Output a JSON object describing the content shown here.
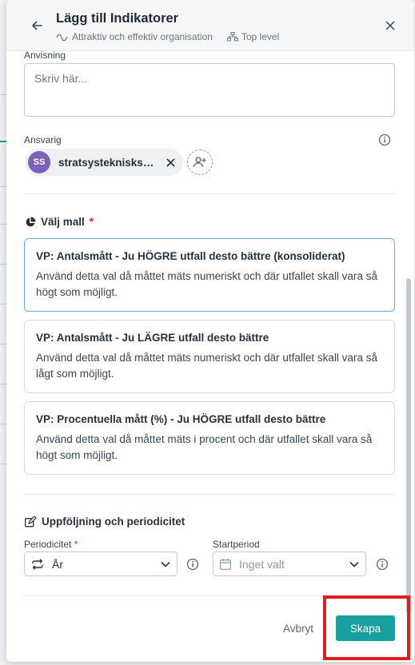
{
  "header": {
    "title": "Lägg till Indikatorer",
    "breadcrumb_item1": "Attraktiv och effektiv organisation",
    "breadcrumb_item2": "Top level"
  },
  "instructions": {
    "label": "Anvisning",
    "placeholder": "Skriv här..."
  },
  "responsible": {
    "label": "Ansvarig",
    "user_initials": "SS",
    "user_name": "stratsysteknisksupport"
  },
  "template_section": {
    "title": "Välj mall",
    "required_mark": "*",
    "templates": [
      {
        "title": "VP: Antalsmått - Ju HÖGRE utfall desto bättre (konsoliderat)",
        "description": "Använd detta val då måttet mäts numeriskt och där utfallet skall vara så högt som möjligt.",
        "selected": true
      },
      {
        "title": "VP: Antalsmått - Ju LÄGRE utfall desto bättre",
        "description": "Använd detta val då måttet mäts numeriskt och där utfallet skall vara så lågt som möjligt.",
        "selected": false
      },
      {
        "title": "VP: Procentuella mått (%) - Ju HÖGRE utfall desto bättre",
        "description": "Använd detta val då måttet mäts i procent och där utfallet skall vara så högt som möjligt.",
        "selected": false
      }
    ]
  },
  "followup_section": {
    "title": "Uppföljning och periodicitet",
    "periodicity_label": "Periodicitet",
    "periodicity_required": "*",
    "periodicity_value": "År",
    "start_period_label": "Startperiod",
    "start_period_placeholder": "Inget valt"
  },
  "footer": {
    "cancel_label": "Avbryt",
    "create_label": "Skapa"
  },
  "colors": {
    "primary": "#189fa0",
    "avatar": "#7b62b8",
    "highlight": "#e01c1c",
    "selected_border": "#6fa8dc"
  }
}
